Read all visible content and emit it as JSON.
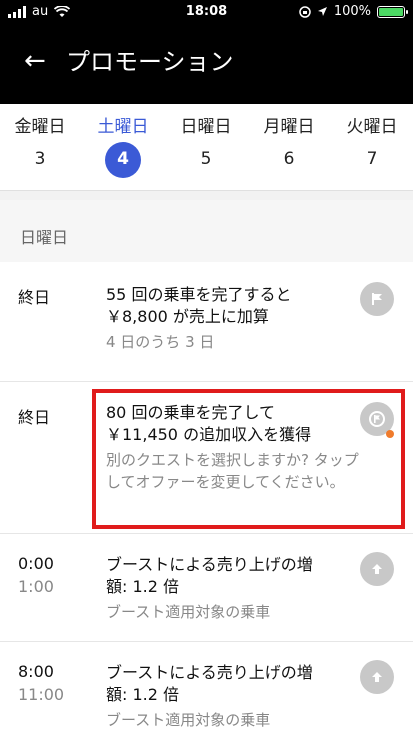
{
  "status": {
    "carrier": "au",
    "time": "18:08",
    "battery": "100%"
  },
  "header": {
    "back_glyph": "←",
    "title": "プロモーション"
  },
  "days": [
    {
      "name": "金曜日",
      "num": "3"
    },
    {
      "name": "土曜日",
      "num": "4"
    },
    {
      "name": "日曜日",
      "num": "5"
    },
    {
      "name": "月曜日",
      "num": "6"
    },
    {
      "name": "火曜日",
      "num": "7"
    }
  ],
  "section_title": "日曜日",
  "items": [
    {
      "time": "終日",
      "line1": "55 回の乗車を完了すると",
      "line2": "￥8,800 が売上に加算",
      "sub": "4 日のうち 3 日"
    },
    {
      "time": "終日",
      "line1": "80 回の乗車を完了して",
      "line2": "￥11,450 の追加収入を獲得",
      "sub": "別のクエストを選択しますか? タップしてオファーを変更してください。"
    },
    {
      "time_start": "0:00",
      "time_end": "1:00",
      "line1": "ブーストによる売り上げの増",
      "line2": "額: 1.2 倍",
      "sub": "ブースト適用対象の乗車"
    },
    {
      "time_start": "8:00",
      "time_end": "11:00",
      "line1": "ブーストによる売り上げの増",
      "line2": "額: 1.2 倍",
      "sub": "ブースト適用対象の乗車"
    }
  ]
}
